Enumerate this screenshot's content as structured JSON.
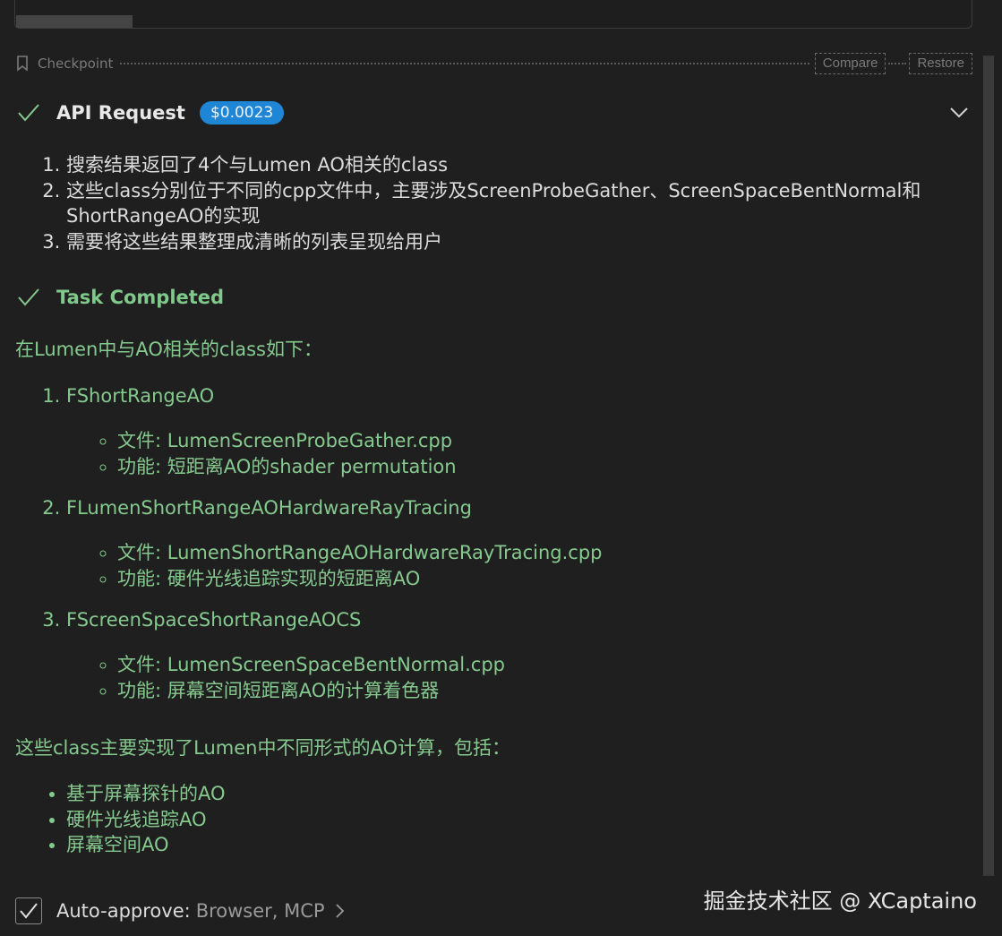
{
  "checkpoint": {
    "label": "Checkpoint",
    "compare_label": "Compare",
    "restore_label": "Restore"
  },
  "api_request": {
    "title": "API Request",
    "cost": "$0.0023"
  },
  "reasoning": [
    "搜索结果返回了4个与Lumen AO相关的class",
    "这些class分别位于不同的cpp文件中，主要涉及ScreenProbeGather、ScreenSpaceBentNormal和ShortRangeAO的实现",
    "需要将这些结果整理成清晰的列表呈现给用户"
  ],
  "task": {
    "title": "Task Completed",
    "intro": "在Lumen中与AO相关的class如下：",
    "classes": [
      {
        "name": "FShortRangeAO",
        "file": "文件: LumenScreenProbeGather.cpp",
        "function": "功能: 短距离AO的shader permutation"
      },
      {
        "name": "FLumenShortRangeAOHardwareRayTracing",
        "file": "文件: LumenShortRangeAOHardwareRayTracing.cpp",
        "function": "功能: 硬件光线追踪实现的短距离AO"
      },
      {
        "name": "FScreenSpaceShortRangeAOCS",
        "file": "文件: LumenScreenSpaceBentNormal.cpp",
        "function": "功能: 屏幕空间短距离AO的计算着色器"
      }
    ],
    "summary": "这些class主要实现了Lumen中不同形式的AO计算，包括：",
    "bullets": [
      "基于屏幕探针的AO",
      "硬件光线追踪AO",
      "屏幕空间AO"
    ]
  },
  "auto_approve": {
    "label": "Auto-approve:",
    "value": "Browser, MCP"
  },
  "watermark": "掘金技术社区 @ XCaptaino",
  "colors": {
    "background": "#1f1f1f",
    "accent_badge": "#1f86d6",
    "success_green": "#86c98f"
  }
}
